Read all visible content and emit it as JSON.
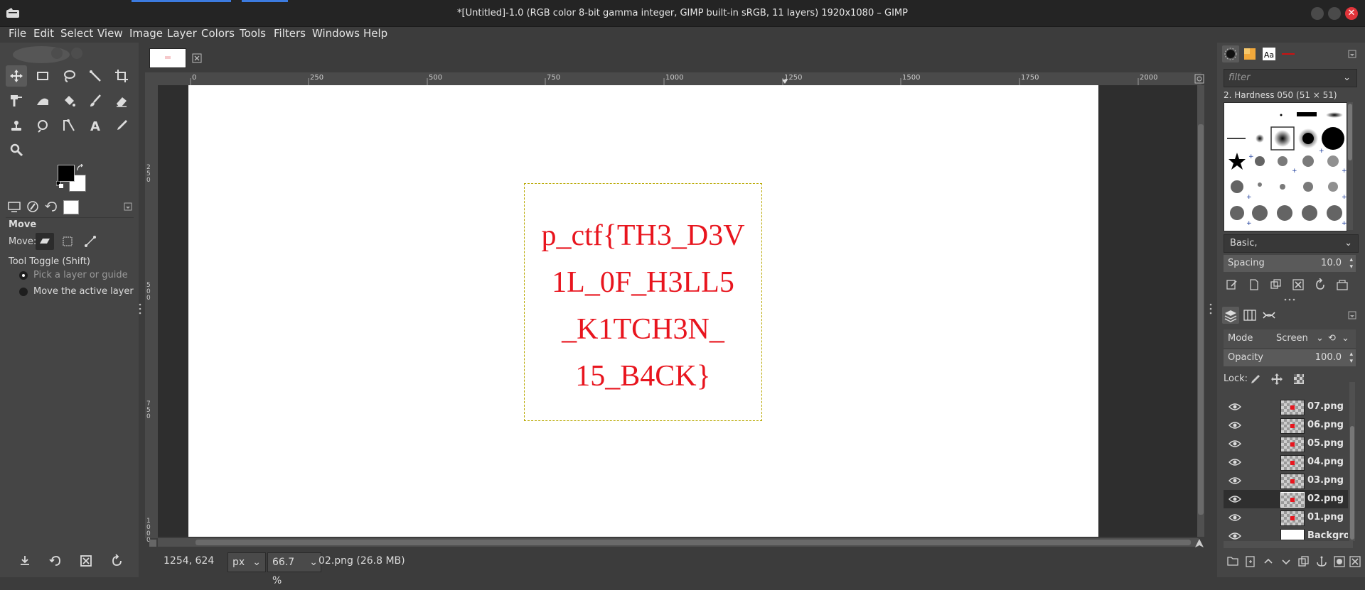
{
  "window": {
    "title": "*[Untitled]-1.0 (RGB color 8-bit gamma integer, GIMP built-in sRGB, 11 layers) 1920x1080 – GIMP",
    "close_symbol": "✕"
  },
  "menu": [
    "File",
    "Edit",
    "Select",
    "View",
    "Image",
    "Layer",
    "Colors",
    "Tools",
    "Filters",
    "Windows",
    "Help"
  ],
  "ruler": {
    "top_ticks": [
      "0",
      "250",
      "500",
      "750",
      "1000",
      "1250",
      "1500",
      "1750",
      "2000"
    ],
    "left_ticks": [
      "250",
      "500",
      "750",
      "1000"
    ]
  },
  "tool_options": {
    "title": "Move",
    "move_label": "Move:",
    "toggle_label": "Tool Toggle  (Shift)",
    "radio_pick": "Pick a layer or guide",
    "radio_move": "Move the active layer"
  },
  "canvas": {
    "flag_lines": [
      "p_ctf{TH3_D3V",
      "1L_0F_H3LL5",
      "_K1TCH3N_",
      "15_B4CK}"
    ],
    "text_color": "#e8151e"
  },
  "status": {
    "coords": "1254, 624",
    "unit": "px",
    "zoom": "66.7 %",
    "info": "02.png (26.8 MB)"
  },
  "brushes": {
    "filter_placeholder": "filter",
    "selected_brush": "2. Hardness 050 (51 × 51)",
    "preset": "Basic,",
    "spacing_label": "Spacing",
    "spacing_value": "10.0"
  },
  "layers": {
    "mode_label": "Mode",
    "mode_value": "Screen",
    "opacity_label": "Opacity",
    "opacity_value": "100.0",
    "lock_label": "Lock:",
    "items": [
      {
        "name": "07.png",
        "selected": false
      },
      {
        "name": "06.png",
        "selected": false
      },
      {
        "name": "05.png",
        "selected": false
      },
      {
        "name": "04.png",
        "selected": false
      },
      {
        "name": "03.png",
        "selected": false
      },
      {
        "name": "02.png",
        "selected": true
      },
      {
        "name": "01.png",
        "selected": false
      },
      {
        "name": "Backgrou",
        "selected": false
      }
    ]
  },
  "colors": {
    "accent": "#3c7be0",
    "close_button": "#e0343a",
    "foreground": "#000000",
    "background": "#ffffff"
  }
}
